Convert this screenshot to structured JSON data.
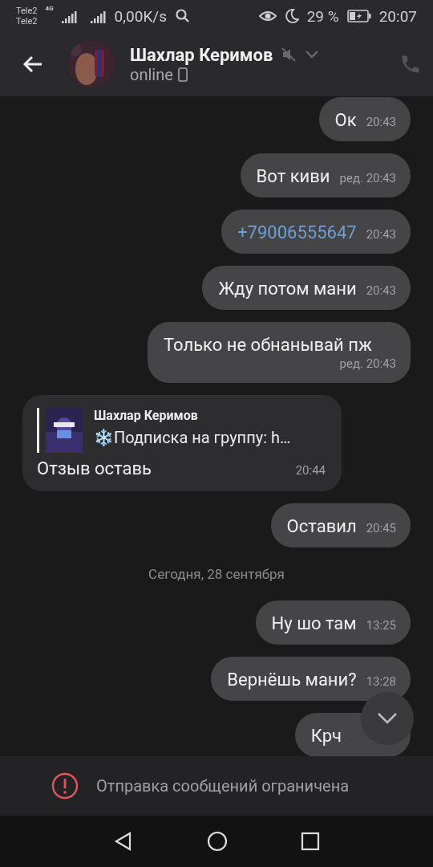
{
  "status_bar": {
    "carrier_1": "Tele2",
    "carrier_2": "Tele2",
    "network": "4G",
    "speed": "0,00K/s",
    "battery": "29 %",
    "time": "20:07"
  },
  "header": {
    "name": "Шахлар Керимов",
    "status": "online",
    "muted": true
  },
  "messages": [
    {
      "kind": "text",
      "outgoing": true,
      "text": "Ок",
      "time": "20:43"
    },
    {
      "kind": "text",
      "outgoing": true,
      "text": "Вот киви",
      "time": "ред. 20:43"
    },
    {
      "kind": "link",
      "outgoing": true,
      "text": "+79006555647",
      "time": "20:43"
    },
    {
      "kind": "text",
      "outgoing": true,
      "text": "Жду потом мани",
      "time": "20:43"
    },
    {
      "kind": "text",
      "outgoing": true,
      "text": "Только не обнанывай пж",
      "time": "ред. 20:43"
    },
    {
      "kind": "reply",
      "outgoing": false,
      "quote_author": "Шахлар Керимов",
      "quote_text": "❄️Подписка на группу: h…",
      "text": "Отзыв оставь",
      "time": "20:44"
    },
    {
      "kind": "text",
      "outgoing": true,
      "text": "Оставил",
      "time": "20:45"
    },
    {
      "kind": "date",
      "text": "Сегодня, 28 сентября"
    },
    {
      "kind": "text",
      "outgoing": true,
      "text": "Ну шо там",
      "time": "13:25"
    },
    {
      "kind": "text",
      "outgoing": true,
      "text": "Вернёшь мани?",
      "time": "13:28"
    },
    {
      "kind": "text",
      "outgoing": true,
      "text": "Крч"
    }
  ],
  "notice": "Отправка сообщений ограничена"
}
